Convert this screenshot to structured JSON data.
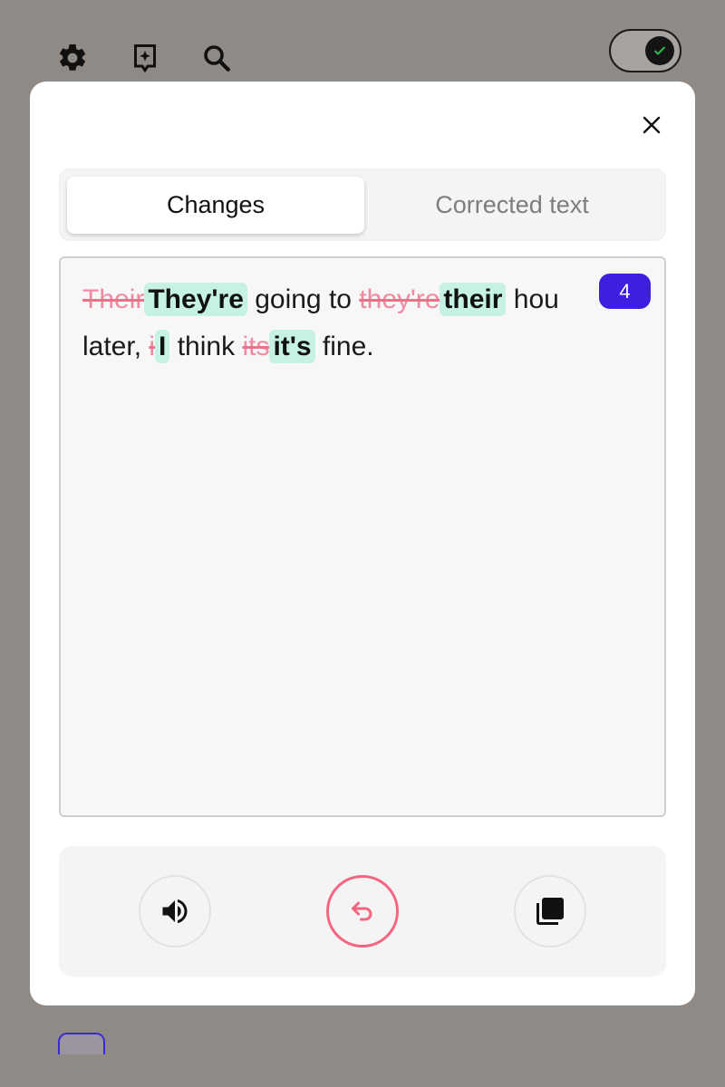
{
  "topbar": {
    "icons": [
      "gear-icon",
      "sparkle-bookmark-icon",
      "search-icon"
    ],
    "toggle_state": "on"
  },
  "modal": {
    "tabs": [
      {
        "label": "Changes",
        "active": true
      },
      {
        "label": "Corrected text",
        "active": false
      }
    ],
    "change_count": "4",
    "text": {
      "line1": {
        "del1": "Their",
        "ins1": "They're",
        "plain1": " going to ",
        "del2": "they're",
        "ins2": "their",
        "plain2": " hou"
      },
      "line2": {
        "plain1": "later, ",
        "del1": "i",
        "ins1": "I",
        "plain2": " think ",
        "del2": "its",
        "ins2": "it's",
        "plain3": " fine."
      }
    },
    "actions": [
      "speaker-icon",
      "undo-icon",
      "copy-icon"
    ]
  },
  "colors": {
    "accent": "#3d1fe0",
    "deletion": "#f08aa0",
    "insertion_bg": "#c5f2e2",
    "undo": "#f5657f",
    "overlay": "#8f8a86"
  }
}
